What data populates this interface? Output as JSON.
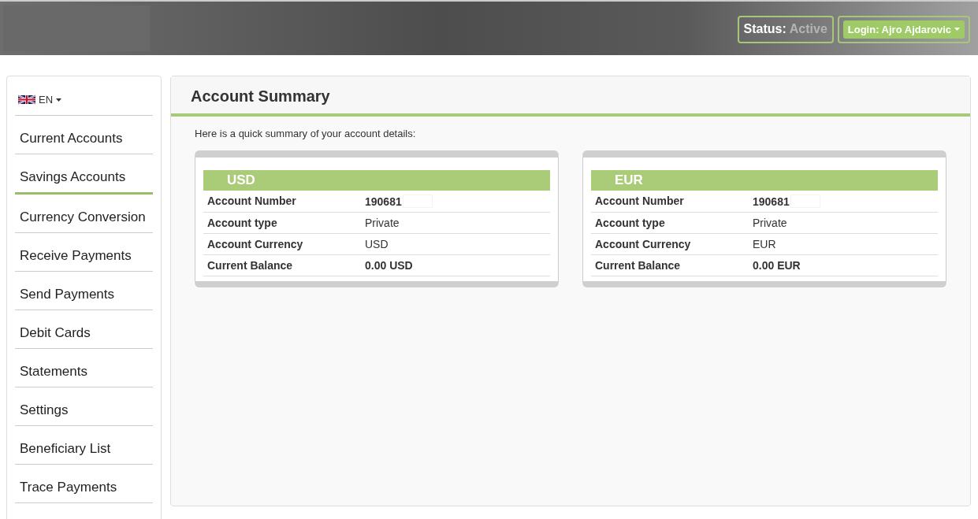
{
  "header": {
    "status_label": "Status:",
    "status_value": "Active",
    "login": "Login: Ajro Ajdarovic"
  },
  "sidebar": {
    "language": "EN",
    "items": [
      {
        "label": "Current Accounts",
        "selected": false
      },
      {
        "label": "Savings Accounts",
        "selected": true
      },
      {
        "label": "Currency Conversion",
        "selected": false
      },
      {
        "label": "Receive Payments",
        "selected": false
      },
      {
        "label": "Send Payments",
        "selected": false
      },
      {
        "label": "Debit Cards",
        "selected": false
      },
      {
        "label": "Statements",
        "selected": false
      },
      {
        "label": "Settings",
        "selected": false
      },
      {
        "label": "Beneficiary List",
        "selected": false
      },
      {
        "label": "Trace Payments",
        "selected": false
      }
    ]
  },
  "main": {
    "title": "Account Summary",
    "intro": "Here is a quick summary of your account details:",
    "accounts": [
      {
        "currency": "USD",
        "rows": [
          {
            "label": "Account Number",
            "value": "190681",
            "bold": true,
            "redacted": true
          },
          {
            "label": "Account type",
            "value": "Private",
            "bold": false,
            "redacted": false
          },
          {
            "label": "Account Currency",
            "value": "USD",
            "bold": false,
            "redacted": false
          },
          {
            "label": "Current Balance",
            "value": "0.00 USD",
            "bold": true,
            "redacted": false
          }
        ]
      },
      {
        "currency": "EUR",
        "rows": [
          {
            "label": "Account Number",
            "value": "190681",
            "bold": true,
            "redacted": true
          },
          {
            "label": "Account type",
            "value": "Private",
            "bold": false,
            "redacted": false
          },
          {
            "label": "Account Currency",
            "value": "EUR",
            "bold": false,
            "redacted": false
          },
          {
            "label": "Current Balance",
            "value": "0.00 EUR",
            "bold": true,
            "redacted": false
          }
        ]
      }
    ]
  }
}
